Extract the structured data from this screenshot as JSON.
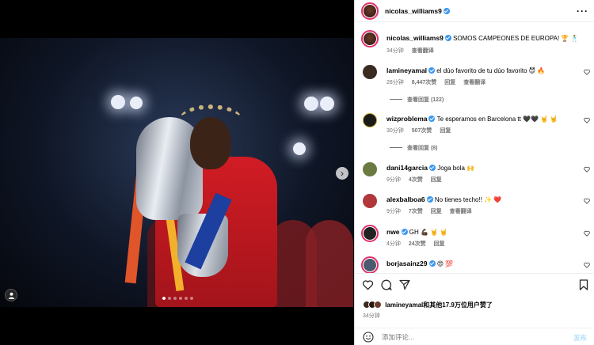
{
  "post": {
    "author": "nicolas_williams9",
    "more_icon": "ellipsis-icon"
  },
  "caption": {
    "author": "nicolas_williams9",
    "text": "SOMOS CAMPEONES DE EUROPA! 🏆 🕺",
    "time": "34分钟",
    "translate": "查看翻译"
  },
  "comments": [
    {
      "author": "lamineyamal",
      "verified": true,
      "text": "el dúo favorito de tu dúo favorito 😈 🔥",
      "time": "28分钟",
      "likes": "8,447次赞",
      "reply": "回复",
      "translate": "查看翻译",
      "view_replies": "查看回复 (122)"
    },
    {
      "author": "wizproblema",
      "verified": true,
      "text": "Te esperamos en Barcelona tt 🖤🖤 🤘 🤘",
      "time": "30分钟",
      "likes": "507次赞",
      "reply": "回复",
      "translate": "",
      "view_replies": "查看回复 (8)"
    },
    {
      "author": "dani14garcia",
      "verified": true,
      "text": "Joga bola 🙌",
      "time": "9分钟",
      "likes": "4次赞",
      "reply": "回复",
      "translate": "",
      "view_replies": ""
    },
    {
      "author": "alexbalboa6",
      "verified": true,
      "text": "No tienes techo!! ✨ ❤️",
      "time": "9分钟",
      "likes": "7次赞",
      "reply": "回复",
      "translate": "查看翻译",
      "view_replies": ""
    },
    {
      "author": "nwe",
      "verified": true,
      "text": "GH 💪🏿 🤘 🤘",
      "time": "4分钟",
      "likes": "24次赞",
      "reply": "回复",
      "translate": "",
      "view_replies": ""
    },
    {
      "author": "borjasainz29",
      "verified": true,
      "text": "😍 💯",
      "time": "",
      "likes": "",
      "reply": "",
      "translate": "",
      "view_replies": ""
    }
  ],
  "likes_line": {
    "user": "lamineyamal",
    "rest": "和其他17.9万位用户赞了"
  },
  "post_time": "34分钟",
  "composer": {
    "placeholder": "添加评论...",
    "post_label": "发布"
  },
  "carousel": {
    "slides": 6,
    "active": 0
  },
  "colors": {
    "verified": "#3897f0",
    "link_blue": "#b2dffc",
    "muted": "#737373"
  }
}
